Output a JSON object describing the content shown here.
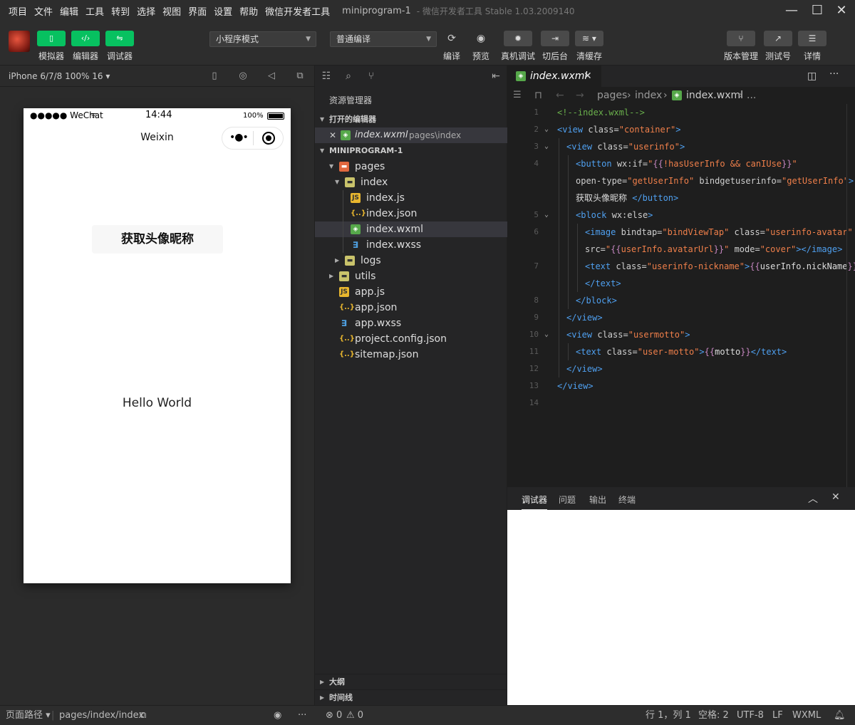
{
  "menubar": {
    "items": [
      "项目",
      "文件",
      "编辑",
      "工具",
      "转到",
      "选择",
      "视图",
      "界面",
      "设置",
      "帮助",
      "微信开发者工具"
    ],
    "project_name": "miniprogram-1",
    "app_version": "- 微信开发者工具 Stable 1.03.2009140"
  },
  "toolbar": {
    "simulator_label": "模拟器",
    "editor_label": "编辑器",
    "debugger_label": "调试器",
    "mode_select": "小程序模式",
    "compile_select": "普通编译",
    "compile_label": "编译",
    "preview_label": "预览",
    "real_debug_label": "真机调试",
    "background_label": "切后台",
    "clear_cache_label": "清缓存",
    "version_label": "版本管理",
    "test_label": "测试号",
    "details_label": "详情"
  },
  "simulator": {
    "device": "iPhone 6/7/8 100% 16",
    "carrier": "●●●●● WeChat",
    "time": "14:44",
    "battery": "100%",
    "nav_title": "Weixin",
    "button_text": "获取头像昵称",
    "hello_text": "Hello World"
  },
  "explorer": {
    "title": "资源管理器",
    "open_editors": "打开的编辑器",
    "open_file": "index.wxml",
    "open_file_path": "pages\\index",
    "project_root": "MINIPROGRAM-1",
    "outline": "大纲",
    "timeline": "时间线",
    "tree": [
      {
        "name": "pages",
        "type": "folder-red",
        "depth": 1,
        "open": true
      },
      {
        "name": "index",
        "type": "folder",
        "depth": 2,
        "open": true
      },
      {
        "name": "index.js",
        "type": "js",
        "depth": 3
      },
      {
        "name": "index.json",
        "type": "json",
        "depth": 3
      },
      {
        "name": "index.wxml",
        "type": "wxml",
        "depth": 3,
        "selected": true
      },
      {
        "name": "index.wxss",
        "type": "wxss",
        "depth": 3
      },
      {
        "name": "logs",
        "type": "folder",
        "depth": 2,
        "open": false
      },
      {
        "name": "utils",
        "type": "folder",
        "depth": 1,
        "open": false
      },
      {
        "name": "app.js",
        "type": "js",
        "depth": 1
      },
      {
        "name": "app.json",
        "type": "json",
        "depth": 1
      },
      {
        "name": "app.wxss",
        "type": "wxss",
        "depth": 1
      },
      {
        "name": "project.config.json",
        "type": "json",
        "depth": 1
      },
      {
        "name": "sitemap.json",
        "type": "json",
        "depth": 1
      }
    ]
  },
  "editor": {
    "tab_title": "index.wxml",
    "breadcrumb": [
      "pages",
      "index",
      "index.wxml",
      "..."
    ],
    "lines": [
      {
        "n": "1",
        "fold": false,
        "indent": 0,
        "html": "<span class='t-cmt'>&lt;!--index.wxml--&gt;</span>"
      },
      {
        "n": "2",
        "fold": true,
        "indent": 0,
        "html": "<span class='t-tag'>&lt;view</span> <span class='t-attr'>class=</span><span class='t-str'>\"container\"</span><span class='t-tag'>&gt;</span>"
      },
      {
        "n": "3",
        "fold": true,
        "indent": 1,
        "html": "<span class='t-tag'>&lt;view</span> <span class='t-attr'>class=</span><span class='t-str'>\"userinfo\"</span><span class='t-tag'>&gt;</span>"
      },
      {
        "n": "4",
        "fold": false,
        "indent": 2,
        "html": "<span class='t-tag'>&lt;button</span> <span class='t-attr'>wx:if=</span><span class='t-str'>\"</span><span class='t-brace'>{{</span><span class='t-str'>!hasUserInfo &amp;&amp; canIUse</span><span class='t-brace'>}}</span><span class='t-str'>\"</span>"
      },
      {
        "n": "",
        "fold": false,
        "indent": 2,
        "html": "<span class='t-attr'>open-type=</span><span class='t-str'>\"getUserInfo\"</span> <span class='t-attr'>bindgetuserinfo=</span><span class='t-str'>\"getUserInfo\"</span><span class='t-tag'>&gt;</span>"
      },
      {
        "n": "",
        "fold": false,
        "indent": 2,
        "html": "<span class='t-txt'>获取头像昵称 </span><span class='t-tag'>&lt;/button&gt;</span>"
      },
      {
        "n": "5",
        "fold": true,
        "indent": 2,
        "html": "<span class='t-tag'>&lt;block</span> <span class='t-attr'>wx:else</span><span class='t-tag'>&gt;</span>"
      },
      {
        "n": "6",
        "fold": false,
        "indent": 3,
        "html": "<span class='t-tag'>&lt;image</span> <span class='t-attr'>bindtap=</span><span class='t-str'>\"bindViewTap\"</span> <span class='t-attr'>class=</span><span class='t-str'>\"userinfo-avatar\"</span>"
      },
      {
        "n": "",
        "fold": false,
        "indent": 3,
        "html": "<span class='t-attr'>src=</span><span class='t-str'>\"</span><span class='t-brace'>{{</span><span class='t-str'>userInfo.avatarUrl</span><span class='t-brace'>}}</span><span class='t-str'>\"</span> <span class='t-attr'>mode=</span><span class='t-str'>\"cover\"</span><span class='t-tag'>&gt;&lt;/image&gt;</span>"
      },
      {
        "n": "7",
        "fold": false,
        "indent": 3,
        "html": "<span class='t-tag'>&lt;text</span> <span class='t-attr'>class=</span><span class='t-str'>\"userinfo-nickname\"</span><span class='t-tag'>&gt;</span><span class='t-brace'>{{</span><span class='t-txt'>userInfo.nickName</span><span class='t-brace'>}}</span>"
      },
      {
        "n": "",
        "fold": false,
        "indent": 3,
        "html": "<span class='t-tag'>&lt;/text&gt;</span>"
      },
      {
        "n": "8",
        "fold": false,
        "indent": 2,
        "html": "<span class='t-tag'>&lt;/block&gt;</span>"
      },
      {
        "n": "9",
        "fold": false,
        "indent": 1,
        "html": "<span class='t-tag'>&lt;/view&gt;</span>"
      },
      {
        "n": "10",
        "fold": true,
        "indent": 1,
        "html": "<span class='t-tag'>&lt;view</span> <span class='t-attr'>class=</span><span class='t-str'>\"usermotto\"</span><span class='t-tag'>&gt;</span>"
      },
      {
        "n": "11",
        "fold": false,
        "indent": 2,
        "html": "<span class='t-tag'>&lt;text</span> <span class='t-attr'>class=</span><span class='t-str'>\"user-motto\"</span><span class='t-tag'>&gt;</span><span class='t-brace'>{{</span><span class='t-txt'>motto</span><span class='t-brace'>}}</span><span class='t-tag'>&lt;/text&gt;</span>"
      },
      {
        "n": "12",
        "fold": false,
        "indent": 1,
        "html": "<span class='t-tag'>&lt;/view&gt;</span>"
      },
      {
        "n": "13",
        "fold": false,
        "indent": 0,
        "html": "<span class='t-tag'>&lt;/view&gt;</span>"
      },
      {
        "n": "14",
        "fold": false,
        "indent": 0,
        "html": ""
      }
    ]
  },
  "debug": {
    "tabs": [
      "调试器",
      "问题",
      "输出",
      "终端"
    ]
  },
  "statusbar": {
    "page_path_label": "页面路径",
    "page_path": "pages/index/index",
    "errors": "0",
    "warnings": "0",
    "cursor": "行 1，列 1",
    "spaces": "空格: 2",
    "encoding": "UTF-8",
    "eol": "LF",
    "language": "WXML"
  }
}
